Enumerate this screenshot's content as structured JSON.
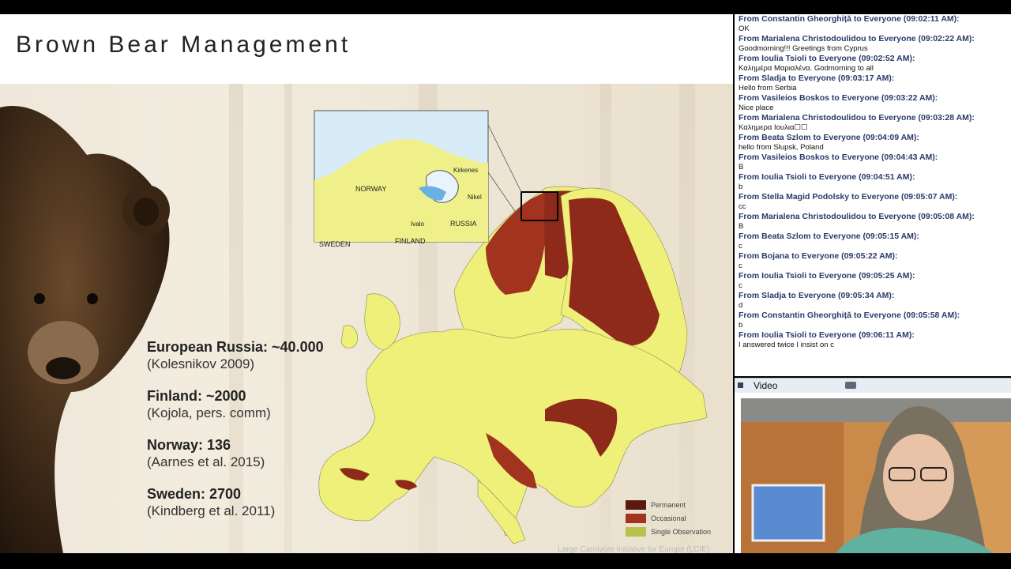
{
  "slide": {
    "title": "Brown Bear Management",
    "stats": [
      {
        "main": "European Russia: ~40.000",
        "source": "(Kolesnikov 2009)"
      },
      {
        "main": "Finland: ~2000",
        "source": "(Kojola, pers. comm)"
      },
      {
        "main": "Norway: 136",
        "source": "(Aarnes et al. 2015)"
      },
      {
        "main": "Sweden: 2700",
        "source": "(Kindberg et al. 2011)"
      }
    ],
    "map_inset_labels": {
      "norway": "NORWAY",
      "russia": "RUSSIA",
      "sweden": "SWEDEN",
      "finland": "FINLAND",
      "kirkenes": "Kirkenes",
      "nikel": "Nikel",
      "ivalo": "Ivalo"
    },
    "legend": [
      {
        "label": "Permanent",
        "color": "#5a1a0e"
      },
      {
        "label": "Occasional",
        "color": "#a2331f"
      },
      {
        "label": "Single Observation",
        "color": "#b8c24a"
      }
    ],
    "credit": "Large Carnivore Initiative for Europe (LCIE)"
  },
  "chat": {
    "messages": [
      {
        "head": "From Constantin Gheorghiță to Everyone (09:02:11 AM):",
        "body": "OK"
      },
      {
        "head": "From Marialena Christodoulidou to Everyone (09:02:22 AM):",
        "body": "Goodmorning!!! Greetings from Cyprus"
      },
      {
        "head": "From Ioulia Tsioli to Everyone (09:02:52 AM):",
        "body": "Καλημέρα Μαριαλένα. Godmorning to all"
      },
      {
        "head": "From Sladja to Everyone (09:03:17 AM):",
        "body": "Hello from Serbia"
      },
      {
        "head": "From Vasileios Boskos to Everyone (09:03:22 AM):",
        "body": "Nice place"
      },
      {
        "head": "From Marialena Christodoulidou to Everyone (09:03:28 AM):",
        "body": "Καλημερα Ιουλια☐☐"
      },
      {
        "head": "From Beata Szlom to Everyone (09:04:09 AM):",
        "body": "hello from Slupsk, Poland"
      },
      {
        "head": "From Vasileios Boskos to Everyone (09:04:43 AM):",
        "body": "B"
      },
      {
        "head": "From Ioulia Tsioli to Everyone (09:04:51 AM):",
        "body": "b"
      },
      {
        "head": "From Stella Magid Podolsky to Everyone (09:05:07 AM):",
        "body": "cc"
      },
      {
        "head": "From Marialena Christodoulidou to Everyone (09:05:08 AM):",
        "body": "B"
      },
      {
        "head": "From Beata Szlom to Everyone (09:05:15 AM):",
        "body": "c"
      },
      {
        "head": "From Bojana to Everyone (09:05:22 AM):",
        "body": "c"
      },
      {
        "head": "From Ioulia Tsioli to Everyone (09:05:25 AM):",
        "body": "c"
      },
      {
        "head": "From Sladja to Everyone (09:05:34 AM):",
        "body": "d"
      },
      {
        "head": "From Constantin Gheorghiță to Everyone (09:05:58 AM):",
        "body": "b"
      },
      {
        "head": "From Ioulia Tsioli to Everyone (09:06:11 AM):",
        "body": "I answered twice I insist on c"
      }
    ]
  },
  "video": {
    "title": "Video",
    "icons": [
      "panel-icon",
      "camera-icon"
    ]
  }
}
